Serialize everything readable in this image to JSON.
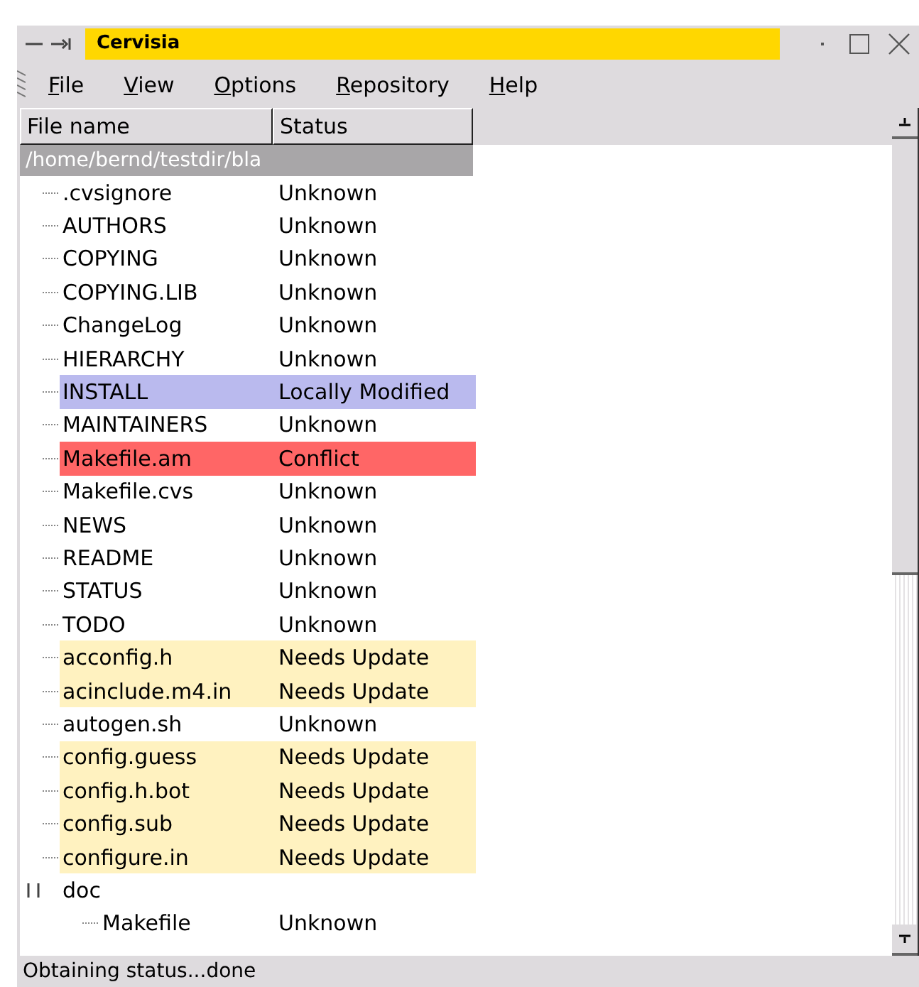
{
  "window": {
    "title": "Cervisia"
  },
  "menu": [
    {
      "label": "File"
    },
    {
      "label": "View"
    },
    {
      "label": "Options"
    },
    {
      "label": "Repository"
    },
    {
      "label": "Help"
    }
  ],
  "columns": [
    "File name",
    "Status"
  ],
  "tree": {
    "path": "/home/bernd/testdir/bla",
    "children": [
      {
        "name": ".cvsignore",
        "status": "Unknown",
        "kind": "unknown"
      },
      {
        "name": "AUTHORS",
        "status": "Unknown",
        "kind": "unknown"
      },
      {
        "name": "COPYING",
        "status": "Unknown",
        "kind": "unknown"
      },
      {
        "name": "COPYING.LIB",
        "status": "Unknown",
        "kind": "unknown"
      },
      {
        "name": "ChangeLog",
        "status": "Unknown",
        "kind": "unknown"
      },
      {
        "name": "HIERARCHY",
        "status": "Unknown",
        "kind": "unknown"
      },
      {
        "name": "INSTALL",
        "status": "Locally Modified",
        "kind": "modified"
      },
      {
        "name": "MAINTAINERS",
        "status": "Unknown",
        "kind": "unknown"
      },
      {
        "name": "Makefile.am",
        "status": "Conflict",
        "kind": "conflict"
      },
      {
        "name": "Makefile.cvs",
        "status": "Unknown",
        "kind": "unknown"
      },
      {
        "name": "NEWS",
        "status": "Unknown",
        "kind": "unknown"
      },
      {
        "name": "README",
        "status": "Unknown",
        "kind": "unknown"
      },
      {
        "name": "STATUS",
        "status": "Unknown",
        "kind": "unknown"
      },
      {
        "name": "TODO",
        "status": "Unknown",
        "kind": "unknown"
      },
      {
        "name": "acconfig.h",
        "status": "Needs Update",
        "kind": "needs-update"
      },
      {
        "name": "acinclude.m4.in",
        "status": "Needs Update",
        "kind": "needs-update"
      },
      {
        "name": "autogen.sh",
        "status": "Unknown",
        "kind": "unknown"
      },
      {
        "name": "config.guess",
        "status": "Needs Update",
        "kind": "needs-update"
      },
      {
        "name": "config.h.bot",
        "status": "Needs Update",
        "kind": "needs-update"
      },
      {
        "name": "config.sub",
        "status": "Needs Update",
        "kind": "needs-update"
      },
      {
        "name": "configure.in",
        "status": "Needs Update",
        "kind": "needs-update"
      },
      {
        "name": "doc",
        "kind": "folder",
        "expanded": true,
        "children": [
          {
            "name": "Makefile",
            "status": "Unknown"
          }
        ]
      }
    ]
  },
  "status_bar": "Obtaining status...done"
}
